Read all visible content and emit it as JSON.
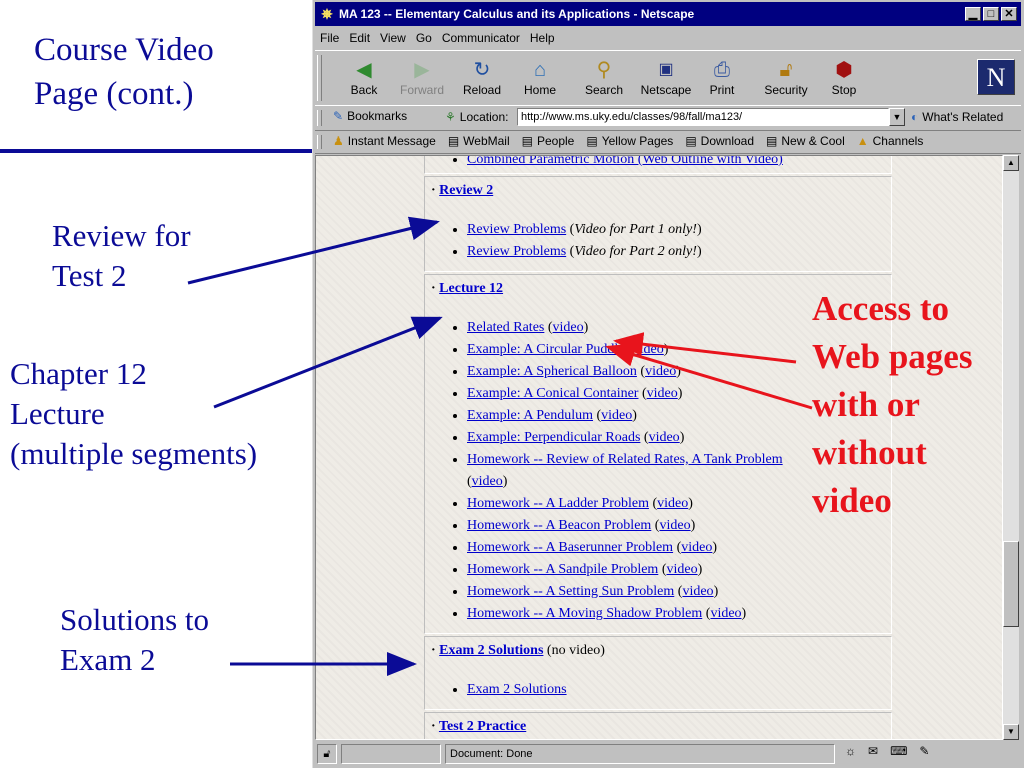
{
  "slide": {
    "title": "Course Video\nPage (cont.)",
    "annotations": {
      "review": "Review for\nTest 2",
      "chapter": "Chapter 12\nLecture\n(multiple segments)",
      "solutions": "Solutions to\nExam 2",
      "access": "Access to\nWeb pages\nwith or\nwithout\nvideo"
    },
    "colors": {
      "annotation_blue": "#0b0b96",
      "annotation_red": "#e8141c",
      "titlebar": "#000080"
    }
  },
  "window": {
    "title": "MA 123 -- Elementary Calculus and its Applications - Netscape",
    "menu": [
      "File",
      "Edit",
      "View",
      "Go",
      "Communicator",
      "Help"
    ],
    "toolbar": [
      {
        "label": "Back",
        "icon": "back-arrow-icon",
        "enabled": true
      },
      {
        "label": "Forward",
        "icon": "forward-arrow-icon",
        "enabled": false
      },
      {
        "label": "Reload",
        "icon": "reload-icon",
        "enabled": true
      },
      {
        "label": "Home",
        "icon": "home-icon",
        "enabled": true
      },
      {
        "label": "Search",
        "icon": "search-icon",
        "enabled": true
      },
      {
        "label": "Netscape",
        "icon": "netscape-icon",
        "enabled": true
      },
      {
        "label": "Print",
        "icon": "print-icon",
        "enabled": true
      },
      {
        "label": "Security",
        "icon": "lock-icon",
        "enabled": true
      },
      {
        "label": "Stop",
        "icon": "stop-icon",
        "enabled": true
      }
    ],
    "logo": "N",
    "location": {
      "bookmarks": "Bookmarks",
      "label": "Location:",
      "url": "http://www.ms.uky.edu/classes/98/fall/ma123/",
      "related": "What's Related"
    },
    "personal": [
      "Instant Message",
      "WebMail",
      "People",
      "Yellow Pages",
      "Download",
      "New & Cool",
      "Channels"
    ],
    "status": "Document: Done"
  },
  "content": {
    "top_item": "Combined Parametric Motion (Web Outline with Video)",
    "review": {
      "heading": "Review 2",
      "items": [
        {
          "link": "Review Problems",
          "note": "Video for Part 1 only!"
        },
        {
          "link": "Review Problems",
          "note": "Video for Part 2 only!"
        }
      ]
    },
    "lecture": {
      "heading": "Lecture 12",
      "video_label": "video",
      "items": [
        "Related Rates",
        "Example: A Circular Puddle",
        "Example: A Spherical Balloon",
        "Example: A Conical Container",
        "Example: A Pendulum",
        "Example: Perpendicular Roads",
        "Homework -- Review of Related Rates, A Tank Problem",
        "Homework -- A Ladder Problem",
        "Homework -- A Beacon Problem",
        "Homework -- A Baserunner Problem",
        "Homework -- A Sandpile Problem",
        "Homework -- A Setting Sun Problem",
        "Homework -- A Moving Shadow Problem"
      ]
    },
    "exam": {
      "heading": "Exam 2 Solutions",
      "note": "(no video)",
      "items": [
        "Exam 2 Solutions"
      ]
    },
    "next_heading": "Test 2 Practice"
  }
}
